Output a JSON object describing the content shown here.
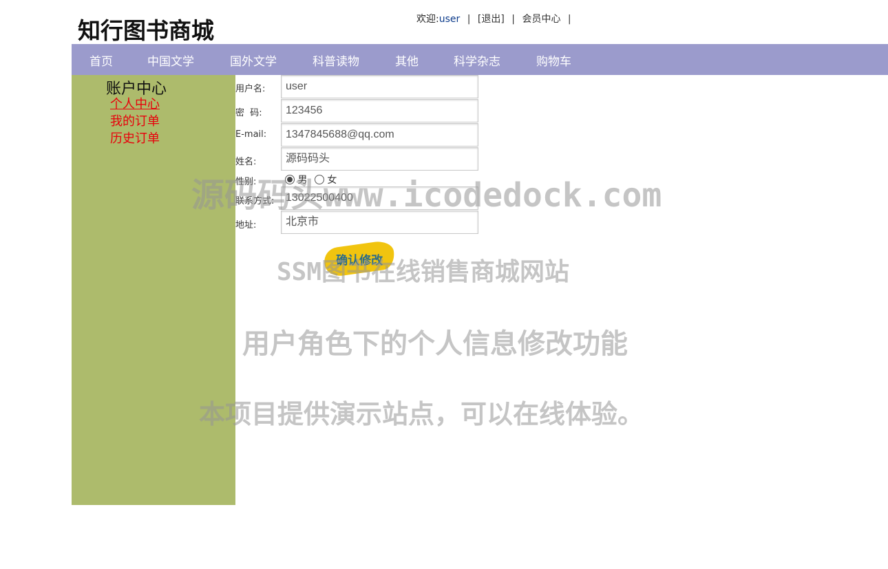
{
  "site": {
    "logo": "知行图书商城"
  },
  "topbar": {
    "welcome_prefix": "欢迎:",
    "username": "user",
    "logout": "[退出]",
    "member_center": "会员中心",
    "separator": "|"
  },
  "nav": {
    "items": [
      "首页",
      "中国文学",
      "国外文学",
      "科普读物",
      "其他",
      "科学杂志",
      "购物车"
    ]
  },
  "sidebar": {
    "title": "账户中心",
    "links": [
      "个人中心",
      "我的订单",
      "历史订单"
    ]
  },
  "form": {
    "username_label": "用户名:",
    "username_value": "user",
    "password_label": "密  码:",
    "password_value": "123456",
    "email_label": "E-mail:",
    "email_value": "1347845688@qq.com",
    "name_label": "姓名:",
    "name_value": "源码码头",
    "gender_label": "性别:",
    "gender_options": [
      "男",
      "女"
    ],
    "gender_selected": "男",
    "phone_label": "联系方式:",
    "phone_value": "13022500400",
    "address_label": "地址:",
    "address_value": "北京市",
    "submit_label": "确认修改"
  },
  "watermark": {
    "line1": "源码码头www.icodedock.com",
    "line2": "SSM图书在线销售商城网站",
    "line3": "用户角色下的个人信息修改功能",
    "line4": "本项目提供演示站点，可以在线体验。"
  },
  "colors": {
    "nav_bg": "#9b9bcc",
    "sidebar_bg": "#adbb6c",
    "link_red": "#e8000b",
    "button_yellow": "#f1c40f"
  }
}
